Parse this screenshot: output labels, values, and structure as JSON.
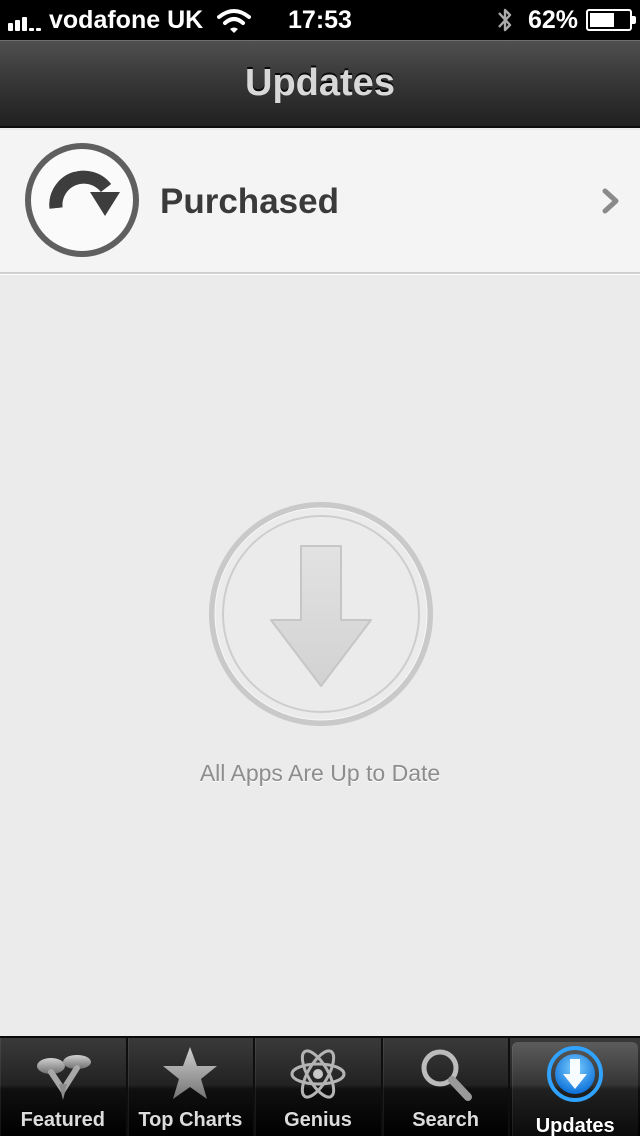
{
  "status_bar": {
    "carrier": "vodafone UK",
    "time": "17:53",
    "battery_percent": "62%",
    "battery_level": 0.62,
    "signal_bars": 3,
    "icons": [
      "signal-bars-icon",
      "wifi-icon",
      "bluetooth-icon",
      "battery-icon"
    ]
  },
  "nav": {
    "title": "Updates"
  },
  "purchased": {
    "label": "Purchased",
    "icon": "purchased-arrow-icon"
  },
  "empty_state": {
    "message": "All Apps Are Up to Date",
    "icon": "download-arrow-icon"
  },
  "tabs": [
    {
      "label": "Featured",
      "icon": "featured-icon",
      "selected": false
    },
    {
      "label": "Top Charts",
      "icon": "star-icon",
      "selected": false
    },
    {
      "label": "Genius",
      "icon": "atom-icon",
      "selected": false
    },
    {
      "label": "Search",
      "icon": "search-icon",
      "selected": false
    },
    {
      "label": "Updates",
      "icon": "updates-icon",
      "selected": true
    }
  ],
  "colors": {
    "accent": "#1a8ff0",
    "background": "#ebebeb",
    "row_background": "#f4f4f4"
  }
}
